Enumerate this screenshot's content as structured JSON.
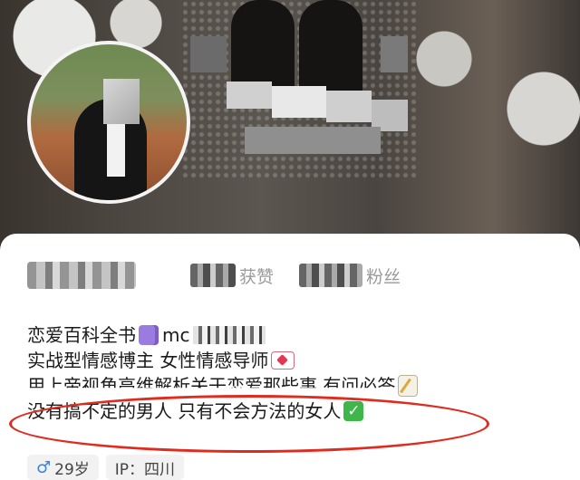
{
  "profile": {
    "stats": [
      {
        "label": "获赞"
      },
      {
        "label": "粉丝"
      }
    ],
    "bio": {
      "line1": "恋爱百科全书",
      "line1_handle_prefix": "mc",
      "line2": "实战型情感博主 女性情感导师",
      "line3": "用上帝视角高维解析关于恋爱那些事 有问必答",
      "line4": "没有搞不定的男人 只有不会方法的女人"
    },
    "tags": {
      "age": "29岁",
      "ip": "IP：四川"
    }
  },
  "icons": {
    "book": "notebook-icon",
    "mail": "love-letter-icon",
    "memo": "memo-icon",
    "check": "check-mark-icon",
    "gender": "male-icon"
  },
  "colors": {
    "highlight": "#e02b1f",
    "check": "#3fb64a",
    "male": "#3a82e0"
  }
}
